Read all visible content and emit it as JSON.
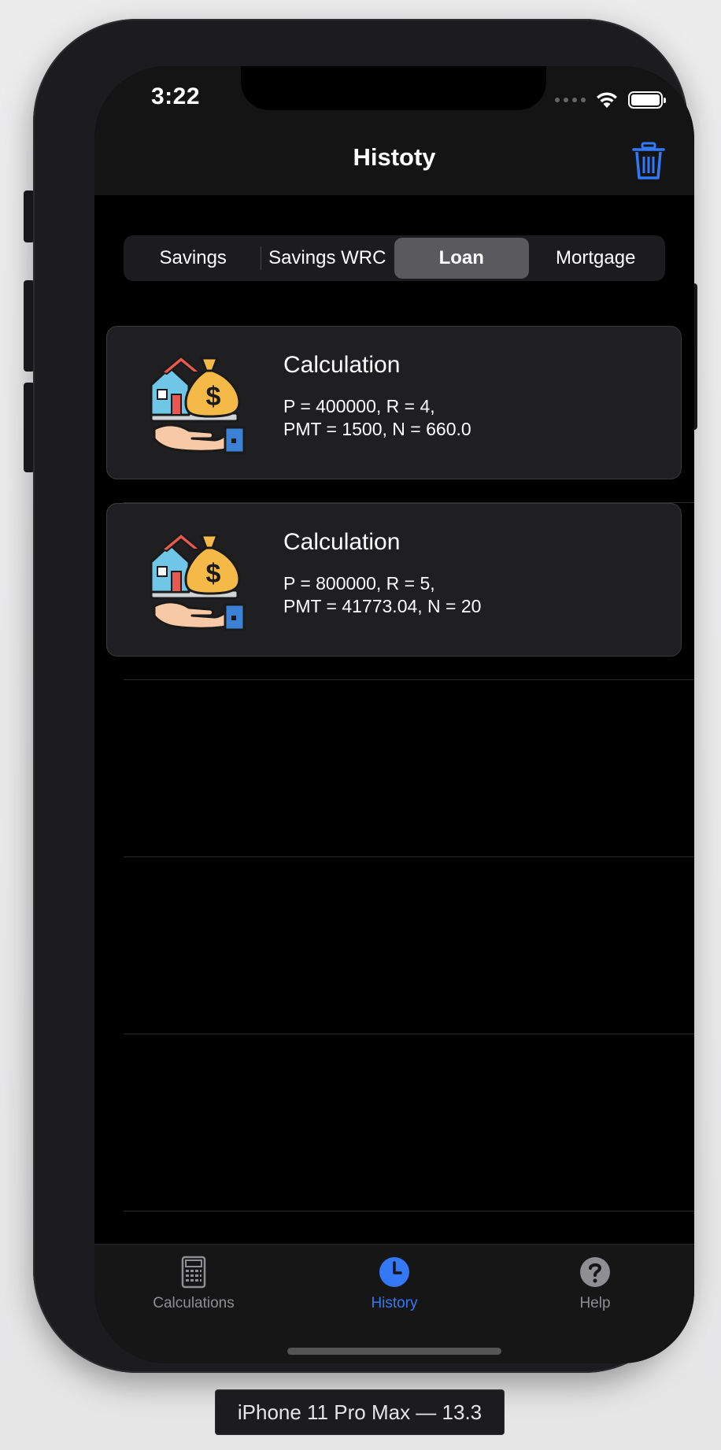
{
  "status_bar": {
    "time": "3:22"
  },
  "nav": {
    "title": "Histoty"
  },
  "segments": [
    {
      "label": "Savings",
      "active": false
    },
    {
      "label": "Savings WRC",
      "active": false
    },
    {
      "label": "Loan",
      "active": true
    },
    {
      "label": "Mortgage",
      "active": false
    }
  ],
  "history": [
    {
      "title": "Calculation",
      "line1": "P = 400000,  R = 4,",
      "line2": "PMT = 1500,  N = 660.0"
    },
    {
      "title": "Calculation",
      "line1": "P = 800000,  R = 5,",
      "line2": "PMT = 41773.04,  N = 20"
    }
  ],
  "tabs": [
    {
      "label": "Calculations",
      "icon": "calculator-icon",
      "active": false
    },
    {
      "label": "History",
      "icon": "clock-icon",
      "active": true
    },
    {
      "label": "Help",
      "icon": "question-icon",
      "active": false
    }
  ],
  "device": {
    "label": "iPhone 11 Pro Max — 13.3"
  },
  "colors": {
    "accent": "#3478f6",
    "background": "#000000",
    "card": "#1f1f21"
  }
}
